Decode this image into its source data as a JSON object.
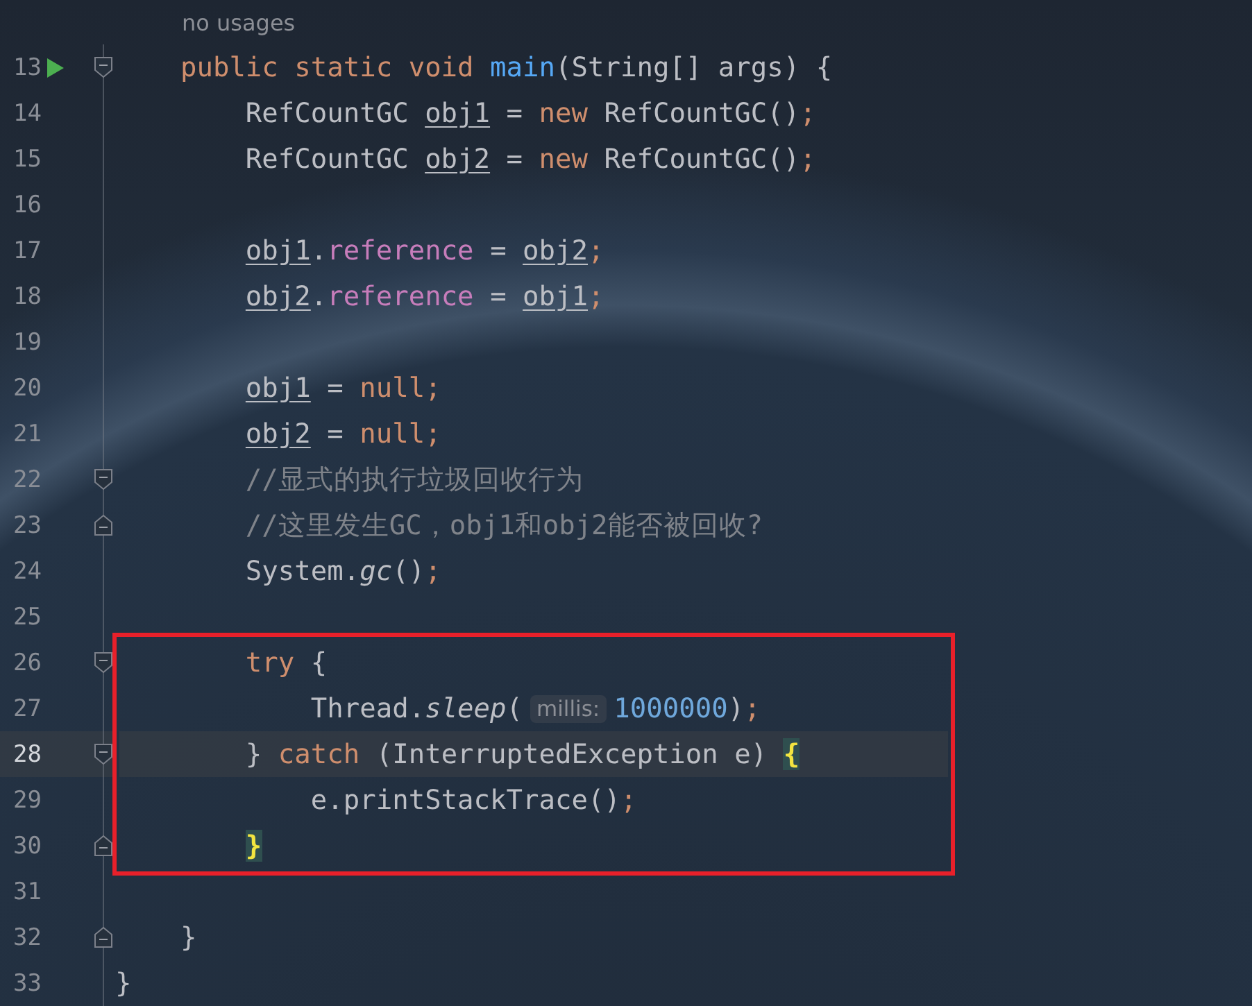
{
  "usage_hint": "no usages",
  "lines_before": [
    {
      "number": "13",
      "run": true,
      "fold_start": true,
      "fold_end": false,
      "current": false,
      "tokens": [
        {
          "kind": "keyword",
          "text": "    public static void "
        },
        {
          "kind": "method",
          "text": "main"
        },
        {
          "kind": "plain",
          "text": "(String[] args) {"
        }
      ]
    },
    {
      "number": "14",
      "run": false,
      "fold_start": false,
      "fold_end": false,
      "current": false,
      "tokens": [
        {
          "kind": "plain",
          "text": "        RefCountGC "
        },
        {
          "kind": "variable",
          "text": "obj1"
        },
        {
          "kind": "plain",
          "text": " = "
        },
        {
          "kind": "keyword",
          "text": "new "
        },
        {
          "kind": "plain",
          "text": "RefCountGC()"
        },
        {
          "kind": "punct",
          "text": ";"
        }
      ]
    },
    {
      "number": "15",
      "run": false,
      "fold_start": false,
      "fold_end": false,
      "current": false,
      "tokens": [
        {
          "kind": "plain",
          "text": "        RefCountGC "
        },
        {
          "kind": "variable",
          "text": "obj2"
        },
        {
          "kind": "plain",
          "text": " = "
        },
        {
          "kind": "keyword",
          "text": "new "
        },
        {
          "kind": "plain",
          "text": "RefCountGC()"
        },
        {
          "kind": "punct",
          "text": ";"
        }
      ]
    },
    {
      "number": "16",
      "run": false,
      "fold_start": false,
      "fold_end": false,
      "current": false
    },
    {
      "number": "17",
      "run": false,
      "fold_start": false,
      "fold_end": false,
      "current": false,
      "tokens": [
        {
          "kind": "variable",
          "text": "        obj1"
        },
        {
          "kind": "plain",
          "text": "."
        },
        {
          "kind": "field",
          "text": "reference"
        },
        {
          "kind": "plain",
          "text": " = "
        },
        {
          "kind": "variable",
          "text": "obj2"
        },
        {
          "kind": "punct",
          "text": ";"
        }
      ]
    },
    {
      "number": "18",
      "run": false,
      "fold_start": false,
      "fold_end": false,
      "current": false,
      "tokens": [
        {
          "kind": "variable",
          "text": "        obj2"
        },
        {
          "kind": "plain",
          "text": "."
        },
        {
          "kind": "field",
          "text": "reference"
        },
        {
          "kind": "plain",
          "text": " = "
        },
        {
          "kind": "variable",
          "text": "obj1"
        },
        {
          "kind": "punct",
          "text": ";"
        }
      ]
    },
    {
      "number": "19",
      "run": false,
      "fold_start": false,
      "fold_end": false,
      "current": false
    },
    {
      "number": "20",
      "run": false,
      "fold_start": false,
      "fold_end": false,
      "current": false,
      "tokens": [
        {
          "kind": "variable",
          "text": "        obj1"
        },
        {
          "kind": "plain",
          "text": " = "
        },
        {
          "kind": "keyword",
          "text": "null"
        },
        {
          "kind": "punct",
          "text": ";"
        }
      ]
    },
    {
      "number": "21",
      "run": false,
      "fold_start": false,
      "fold_end": false,
      "current": false,
      "tokens": [
        {
          "kind": "variable",
          "text": "        obj2"
        },
        {
          "kind": "plain",
          "text": " = "
        },
        {
          "kind": "keyword",
          "text": "null"
        },
        {
          "kind": "punct",
          "text": ";"
        }
      ]
    },
    {
      "number": "22",
      "run": false,
      "fold_start": true,
      "fold_end": false,
      "current": false,
      "tokens": [
        {
          "kind": "comment",
          "text": "        //显式的执行垃圾回收行为"
        }
      ]
    },
    {
      "number": "23",
      "run": false,
      "fold_start": false,
      "fold_end": true,
      "current": false,
      "tokens": [
        {
          "kind": "comment",
          "text": "        //这里发生GC，obj1和obj2能否被回收?"
        }
      ]
    },
    {
      "number": "24",
      "run": false,
      "fold_start": false,
      "fold_end": false,
      "current": false,
      "tokens": [
        {
          "kind": "plain",
          "text": "        System."
        },
        {
          "kind": "static",
          "text": "gc"
        },
        {
          "kind": "plain",
          "text": "()"
        },
        {
          "kind": "punct",
          "text": ";"
        }
      ]
    },
    {
      "number": "25",
      "run": false,
      "fold_start": false,
      "fold_end": false,
      "current": false
    }
  ],
  "highlighted_block": {
    "lines": [
      {
        "number": "26",
        "run": false,
        "fold_start": true,
        "fold_end": false,
        "current": false,
        "tokens": [
          {
            "kind": "keyword",
            "text": "        try "
          },
          {
            "kind": "plain",
            "text": "{"
          }
        ]
      },
      {
        "number": "27",
        "run": false,
        "fold_start": false,
        "fold_end": false,
        "current": false,
        "tokens": [
          {
            "kind": "plain",
            "text": "            Thread."
          },
          {
            "kind": "static",
            "text": "sleep"
          },
          {
            "kind": "plain",
            "text": "("
          },
          {
            "kind": "hint",
            "text": "millis:"
          },
          {
            "kind": "number",
            "text": "1000000"
          },
          {
            "kind": "plain",
            "text": ")"
          },
          {
            "kind": "punct",
            "text": ";"
          }
        ]
      },
      {
        "number": "28",
        "run": false,
        "fold_start": true,
        "fold_end": false,
        "current": true,
        "tokens": [
          {
            "kind": "plain",
            "text": "        } "
          },
          {
            "kind": "keyword",
            "text": "catch "
          },
          {
            "kind": "plain",
            "text": "(InterruptedException e) "
          },
          {
            "kind": "brace",
            "text": "{"
          }
        ]
      },
      {
        "number": "29",
        "run": false,
        "fold_start": false,
        "fold_end": false,
        "current": false,
        "tokens": [
          {
            "kind": "plain",
            "text": "            e.printStackTrace()"
          },
          {
            "kind": "punct",
            "text": ";"
          }
        ]
      },
      {
        "number": "30",
        "run": false,
        "fold_start": false,
        "fold_end": true,
        "current": false,
        "tokens": [
          {
            "kind": "brace",
            "text": "        }"
          }
        ]
      }
    ]
  },
  "lines_after": [
    {
      "number": "31",
      "run": false,
      "fold_start": false,
      "fold_end": false,
      "current": false
    },
    {
      "number": "32",
      "run": false,
      "fold_start": false,
      "fold_end": true,
      "current": false,
      "tokens": [
        {
          "kind": "plain",
          "text": "    }"
        }
      ]
    },
    {
      "number": "33",
      "run": false,
      "fold_start": false,
      "fold_end": false,
      "current": false,
      "tokens": [
        {
          "kind": "plain",
          "text": "}"
        }
      ]
    }
  ]
}
